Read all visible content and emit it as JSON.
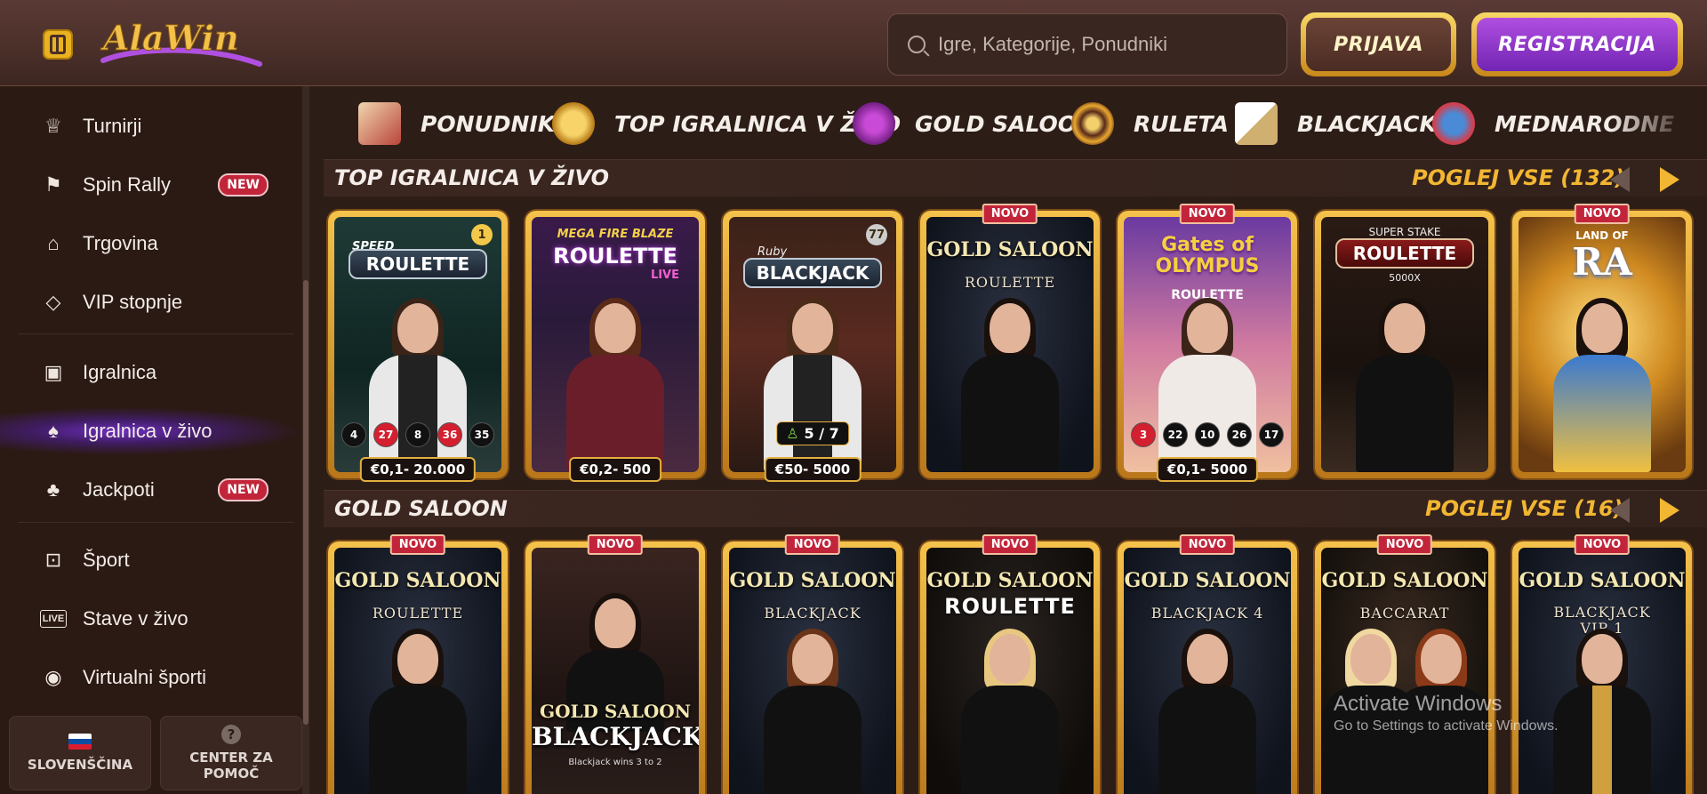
{
  "header": {
    "logo_text": "AlaWin",
    "search_placeholder": "Igre, Kategorije, Ponudniki",
    "login_label": "PRIJAVA",
    "register_label": "REGISTRACIJA"
  },
  "sidebar": {
    "items": [
      {
        "label": "Turnirji",
        "icon": "trophy-icon"
      },
      {
        "label": "Spin Rally",
        "icon": "checkered-flag-icon",
        "badge": "NEW"
      },
      {
        "label": "Trgovina",
        "icon": "shop-icon"
      },
      {
        "label": "VIP stopnje",
        "icon": "diamond-icon"
      },
      {
        "label": "Igralnica",
        "icon": "slot-machine-icon"
      },
      {
        "label": "Igralnica v živo",
        "icon": "cards-icon",
        "active": true
      },
      {
        "label": "Jackpoti",
        "icon": "clover-icon",
        "badge": "NEW"
      },
      {
        "label": "Šport",
        "icon": "pitch-icon"
      },
      {
        "label": "Stave v živo",
        "icon": "live-icon"
      },
      {
        "label": "Virtualni športi",
        "icon": "virtual-ball-icon"
      }
    ],
    "language": "SLOVENŠČINA",
    "help_line1": "CENTER ZA",
    "help_line2": "POMOČ"
  },
  "categories": [
    {
      "label": "PONUDNIKI",
      "icon": "scroll-icon"
    },
    {
      "label": "TOP IGRALNICA V ŽIVO",
      "icon": "chips-icon"
    },
    {
      "label": "GOLD SALOON",
      "icon": "fleur-de-lis-icon"
    },
    {
      "label": "RULETA",
      "icon": "roulette-wheel-icon"
    },
    {
      "label": "BLACKJACK",
      "icon": "playing-cards-icon"
    },
    {
      "label": "MEDNARODNE",
      "icon": "globe-icon"
    }
  ],
  "sections": [
    {
      "title": "TOP IGRALNICA V ŽIVO",
      "view_all": "POGLEJ VSE (132)",
      "cards": [
        {
          "title": "ROULETTE",
          "pre": "SPEED",
          "limit": "€0,1- 20.000",
          "numbers": [
            "4",
            "27",
            "8",
            "36",
            "35"
          ],
          "red": [
            false,
            true,
            false,
            true,
            false
          ],
          "corner": "1"
        },
        {
          "title": "ROULETTE",
          "pre": "MEGA FIRE BLAZE",
          "post": "LIVE",
          "limit": "€0,2- 500"
        },
        {
          "title": "BLACKJACK",
          "pre": "Ruby",
          "limit": "€50- 5000",
          "seats": "5 / 7",
          "corner": "77"
        },
        {
          "title": "GOLD SALOON",
          "sub": "ROULETTE",
          "novo": "NOVO"
        },
        {
          "title": "Gates of OLYMPUS",
          "sub": "ROULETTE",
          "novo": "NOVO",
          "limit": "€0,1- 5000",
          "numbers": [
            "3",
            "22",
            "10",
            "26",
            "17"
          ],
          "red": [
            true,
            false,
            false,
            false,
            false
          ]
        },
        {
          "title": "ROULETTE",
          "pre": "SUPER STAKE",
          "post": "5000X"
        },
        {
          "title": "RA",
          "pre": "LAND OF",
          "novo": "NOVO"
        }
      ]
    },
    {
      "title": "GOLD SALOON",
      "view_all": "POGLEJ VSE (16)",
      "cards": [
        {
          "title": "GOLD SALOON",
          "sub": "ROULETTE",
          "novo": "NOVO"
        },
        {
          "title": "GOLD SALOON",
          "sub": "BLACKJACK",
          "novo": "NOVO",
          "footer": "Blackjack wins 3 to 2"
        },
        {
          "title": "GOLD SALOON",
          "sub": "BLACKJACK",
          "novo": "NOVO"
        },
        {
          "title": "GOLD SALOON",
          "sub": "ROULETTE",
          "novo": "NOVO"
        },
        {
          "title": "GOLD SALOON",
          "sub": "BLACKJACK 4",
          "novo": "NOVO"
        },
        {
          "title": "GOLD SALOON",
          "sub": "BACCARAT",
          "novo": "NOVO"
        },
        {
          "title": "GOLD SALOON",
          "sub": "BLACKJACK VIP 1",
          "novo": "NOVO"
        }
      ]
    }
  ],
  "watermark": {
    "line1": "Activate Windows",
    "line2": "Go to Settings to activate Windows."
  },
  "colors": {
    "gold": "#f2b632",
    "purple": "#7224b3",
    "red_badge": "#c2253a",
    "background": "#2d1d17"
  }
}
